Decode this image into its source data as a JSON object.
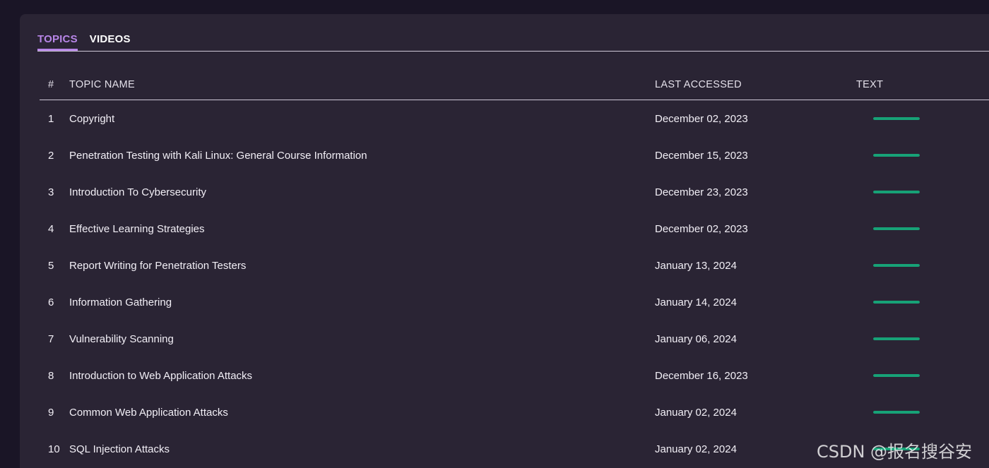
{
  "tabs": [
    {
      "label": "TOPICS",
      "active": true
    },
    {
      "label": "VIDEOS",
      "active": false
    }
  ],
  "table": {
    "headers": {
      "num": "#",
      "name": "TOPIC NAME",
      "last_accessed": "LAST ACCESSED",
      "text": "TEXT"
    },
    "rows": [
      {
        "num": "1",
        "name": "Copyright",
        "date": "December 02, 2023",
        "progress": 1.0
      },
      {
        "num": "2",
        "name": "Penetration Testing with Kali Linux: General Course Information",
        "date": "December 15, 2023",
        "progress": 1.0
      },
      {
        "num": "3",
        "name": "Introduction To Cybersecurity",
        "date": "December 23, 2023",
        "progress": 1.0
      },
      {
        "num": "4",
        "name": "Effective Learning Strategies",
        "date": "December 02, 2023",
        "progress": 1.0
      },
      {
        "num": "5",
        "name": "Report Writing for Penetration Testers",
        "date": "January 13, 2024",
        "progress": 1.0
      },
      {
        "num": "6",
        "name": "Information Gathering",
        "date": "January 14, 2024",
        "progress": 1.0
      },
      {
        "num": "7",
        "name": "Vulnerability Scanning",
        "date": "January 06, 2024",
        "progress": 1.0
      },
      {
        "num": "8",
        "name": "Introduction to Web Application Attacks",
        "date": "December 16, 2023",
        "progress": 1.0
      },
      {
        "num": "9",
        "name": "Common Web Application Attacks",
        "date": "January 02, 2024",
        "progress": 1.0
      },
      {
        "num": "10",
        "name": "SQL Injection Attacks",
        "date": "January 02, 2024",
        "progress": 1.0
      }
    ]
  },
  "watermark": "CSDN @报名搜谷安",
  "colors": {
    "background": "#1a1526",
    "panel": "#2a2434",
    "accent": "#b886e8",
    "progress": "#17a277"
  }
}
